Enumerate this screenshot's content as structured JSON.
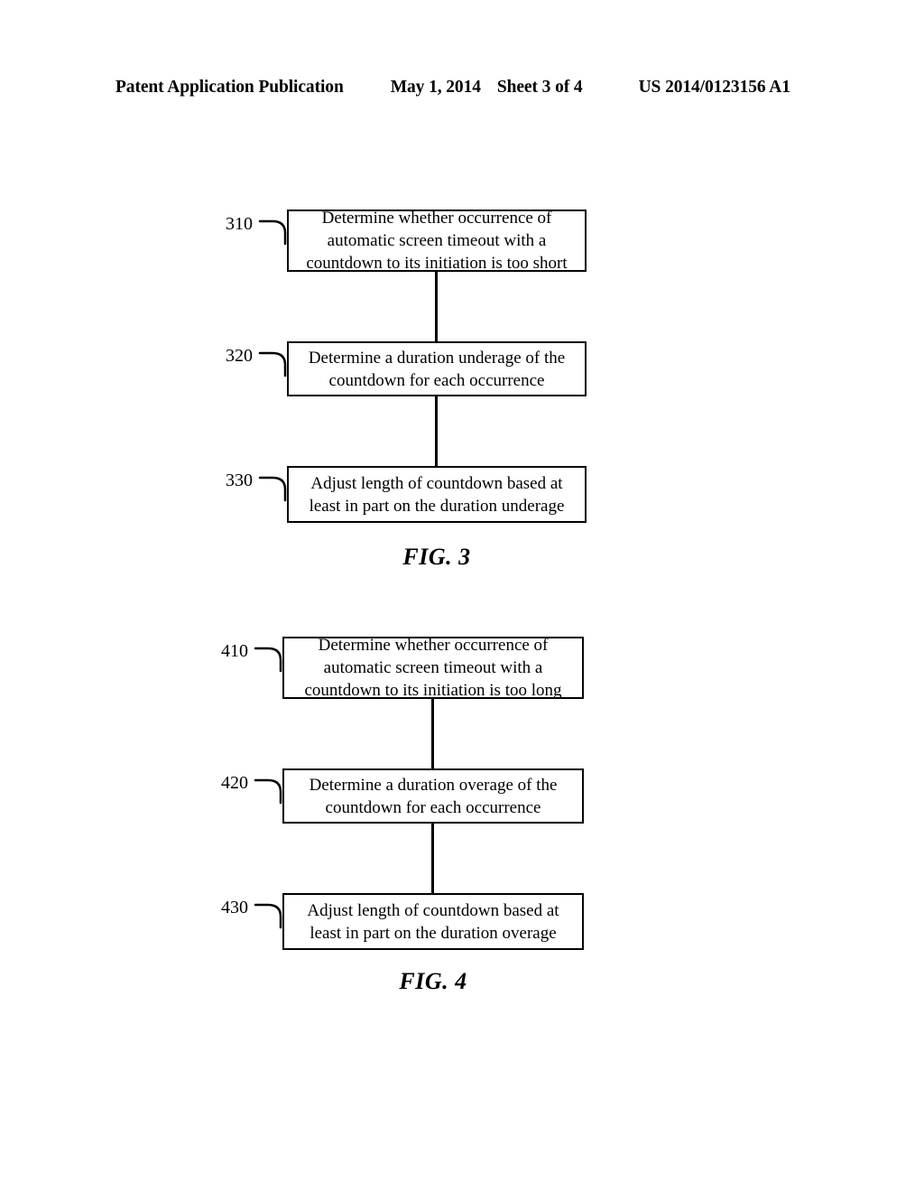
{
  "header": {
    "title": "Patent Application Publication",
    "date": "May 1, 2014",
    "sheet": "Sheet 3 of 4",
    "publication_number": "US 2014/0123156 A1"
  },
  "figures": [
    {
      "caption": "FIG. 3",
      "steps": [
        {
          "ref": "310",
          "lines": [
            "Determine whether occurrence of",
            "automatic screen timeout with a",
            "countdown to its initiation is too short"
          ]
        },
        {
          "ref": "320",
          "lines": [
            "Determine a duration underage of the",
            "countdown for each occurrence"
          ]
        },
        {
          "ref": "330",
          "lines": [
            "Adjust length of countdown based at",
            "least in part on the duration underage"
          ]
        }
      ]
    },
    {
      "caption": "FIG. 4",
      "steps": [
        {
          "ref": "410",
          "lines": [
            "Determine whether occurrence of",
            "automatic screen timeout with a",
            "countdown to its initiation is too long"
          ]
        },
        {
          "ref": "420",
          "lines": [
            "Determine a duration overage of the",
            "countdown for each occurrence"
          ]
        },
        {
          "ref": "430",
          "lines": [
            "Adjust length of countdown based at",
            "least in part on the duration overage"
          ]
        }
      ]
    }
  ]
}
